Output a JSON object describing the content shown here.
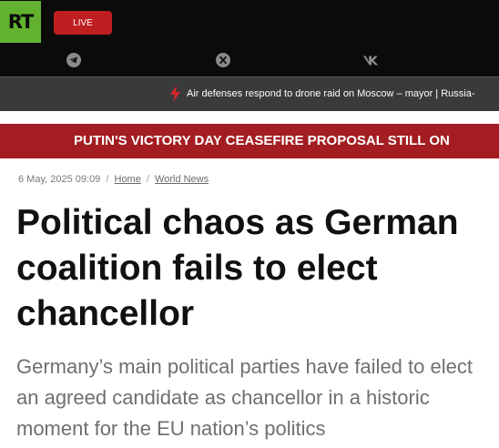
{
  "header": {
    "logo_text": "RT",
    "live_label": "LIVE",
    "social_icons": [
      "telegram-icon",
      "x-icon",
      "vk-icon"
    ]
  },
  "ticker": {
    "text": "Air defenses respond to drone raid on Moscow – mayor | Russia-"
  },
  "banner": {
    "text": "PUTIN'S VICTORY DAY CEASEFIRE PROPOSAL STILL ON"
  },
  "article": {
    "date": "6 May, 2025 09:09",
    "breadcrumbs": [
      "Home",
      "World News"
    ],
    "title": "Political chaos as German coalition fails to elect chancellor",
    "summary": "Germany’s main political parties have failed to elect an agreed candidate as chancellor in a historic moment for the EU nation’s politics"
  },
  "colors": {
    "logo_green": "#62b22f",
    "live_red": "#bf1e20",
    "banner_red": "#a31d22",
    "topbar_black": "#0b0b0b",
    "ticker_grey": "#3a3a3a"
  }
}
